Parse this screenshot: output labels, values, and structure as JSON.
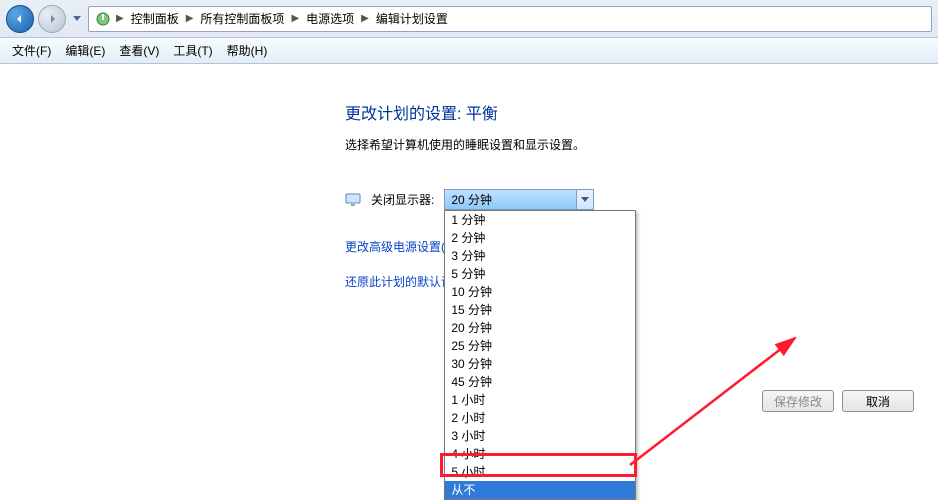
{
  "nav": {
    "crumbs": [
      "控制面板",
      "所有控制面板项",
      "电源选项",
      "编辑计划设置"
    ]
  },
  "menu": {
    "file": "文件(F)",
    "edit": "编辑(E)",
    "view": "查看(V)",
    "tools": "工具(T)",
    "help": "帮助(H)"
  },
  "page": {
    "title": "更改计划的设置: 平衡",
    "subtitle": "选择希望计算机使用的睡眠设置和显示设置。",
    "turn_off_display_label": "关闭显示器:",
    "selected": "20 分钟",
    "advanced_link": "更改高级电源设置(C)",
    "restore_link": "还原此计划的默认设置(R)",
    "options": [
      "1 分钟",
      "2 分钟",
      "3 分钟",
      "5 分钟",
      "10 分钟",
      "15 分钟",
      "20 分钟",
      "25 分钟",
      "30 分钟",
      "45 分钟",
      "1 小时",
      "2 小时",
      "3 小时",
      "4 小时",
      "5 小时",
      "从不"
    ],
    "highlighted_option": "从不"
  },
  "buttons": {
    "save": "保存修改",
    "cancel": "取消"
  }
}
